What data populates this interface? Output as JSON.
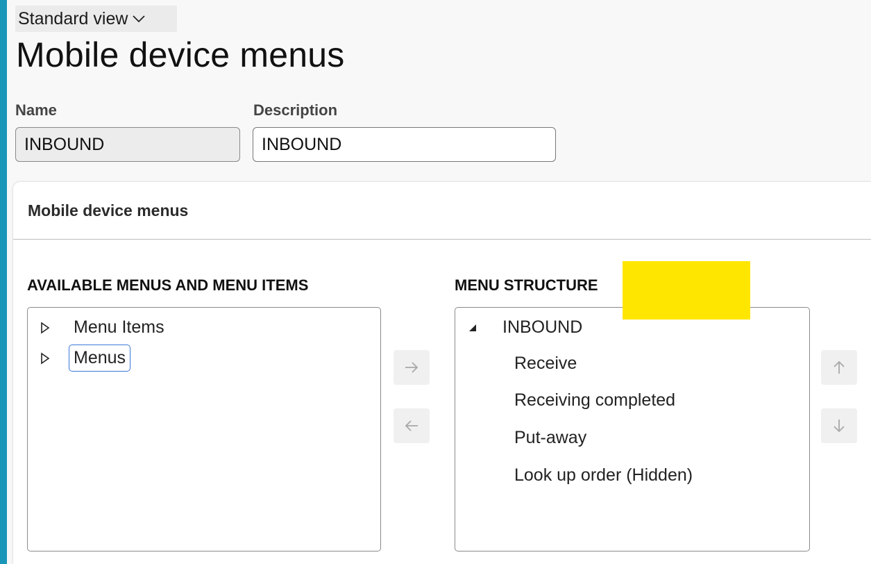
{
  "header": {
    "view_label": "Standard view",
    "title": "Mobile device menus"
  },
  "fields": {
    "name_label": "Name",
    "name_value": "INBOUND",
    "description_label": "Description",
    "description_value": "INBOUND"
  },
  "card": {
    "title": "Mobile device menus",
    "available": {
      "heading": "AVAILABLE MENUS AND MENU ITEMS",
      "items": [
        {
          "label": "Menu Items"
        },
        {
          "label": "Menus"
        }
      ]
    },
    "structure": {
      "heading": "MENU STRUCTURE",
      "root": "INBOUND",
      "children": [
        {
          "label": "Receive"
        },
        {
          "label": "Receiving completed"
        },
        {
          "label": "Put-away"
        },
        {
          "label": "Look up order (Hidden)"
        }
      ]
    }
  },
  "colors": {
    "frame": "#1a96b8",
    "highlight": "#ffe600",
    "focus": "#3a78d6"
  },
  "icons": {
    "view_chevron": "chevron-down-icon",
    "expand_caret": "caret-right-outline-icon",
    "expanded_caret": "caret-down-solid-icon",
    "add": "arrow-right-icon",
    "remove": "arrow-left-icon",
    "move_up": "arrow-up-icon",
    "move_down": "arrow-down-icon"
  }
}
